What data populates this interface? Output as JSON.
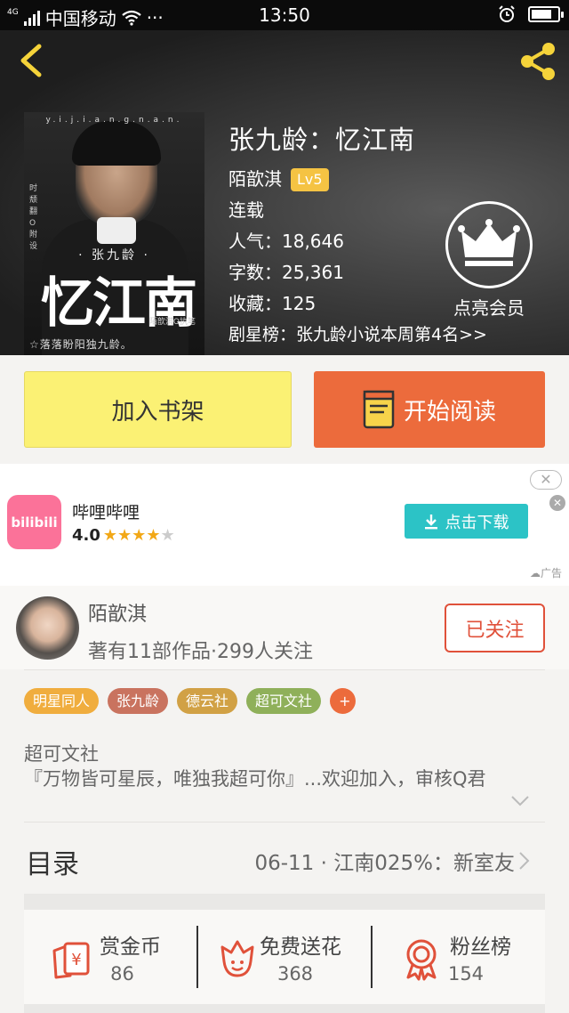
{
  "status_bar": {
    "network": "4G",
    "carrier": "中国移动",
    "dots": "···",
    "time": "13:50",
    "battery_level": 0.8
  },
  "header": {
    "back_icon": "chevron-left-icon",
    "share_icon": "share-icon"
  },
  "book": {
    "title": "张九龄：忆江南",
    "author": "陌歆淇",
    "level": "Lv5",
    "status": "连载",
    "popularity_label": "人气：",
    "popularity": "18,646",
    "words_label": "字数：",
    "words": "25,361",
    "favorites_label": "收藏：",
    "favorites": "125",
    "rank": "剧星榜：张九龄小说本周第4名>>",
    "cover": {
      "pinyin": "y.i.j.i.a.n.g.n.a.n.",
      "vertical": "时 颓 翻 O 附 设",
      "subtitle": "· 张九龄 ·",
      "big_title": "忆江南",
      "pen": "陌歆淇O执笔",
      "tagline": "☆落落盼阳独九龄。"
    }
  },
  "vip": {
    "label": "点亮会员",
    "icon": "crown-icon"
  },
  "actions": {
    "add_shelf": "加入书架",
    "start_read": "开始阅读"
  },
  "ad": {
    "app_icon_text": "bilibili",
    "app_name": "哔哩哔哩",
    "rating": "4.0",
    "stars_filled": 4,
    "stars_total": 5,
    "download": "点击下载",
    "tag": "广告",
    "close_glyph": "✕"
  },
  "author": {
    "name": "陌歆淇",
    "stats": "著有11部作品·299人关注",
    "follow_label": "已关注"
  },
  "tags": [
    {
      "label": "明星同人",
      "color": "#f0ad3e"
    },
    {
      "label": "张九龄",
      "color": "#c9735f"
    },
    {
      "label": "德云社",
      "color": "#d1a145"
    },
    {
      "label": "超可文社",
      "color": "#8fb05a"
    },
    {
      "label": "+",
      "color": "#ec6b3c"
    }
  ],
  "description": {
    "line1": "超可文社",
    "line2": "『万物皆可星辰，唯独我超可你』...欢迎加入，审核Q君"
  },
  "catalog": {
    "label": "目录",
    "latest": "06-11 · 江南025%：新室友"
  },
  "rewards": [
    {
      "label": "赏金币",
      "value": "86",
      "icon": "coin-envelope-icon"
    },
    {
      "label": "免费送花",
      "value": "368",
      "icon": "flower-icon"
    },
    {
      "label": "粉丝榜",
      "value": "154",
      "icon": "medal-icon"
    }
  ],
  "colors": {
    "accent_orange": "#ec6b3c",
    "shelf_yellow": "#fbf174",
    "follow_red": "#e0513a",
    "download_teal": "#2cc3c6",
    "bilibili_pink": "#fb7299"
  }
}
